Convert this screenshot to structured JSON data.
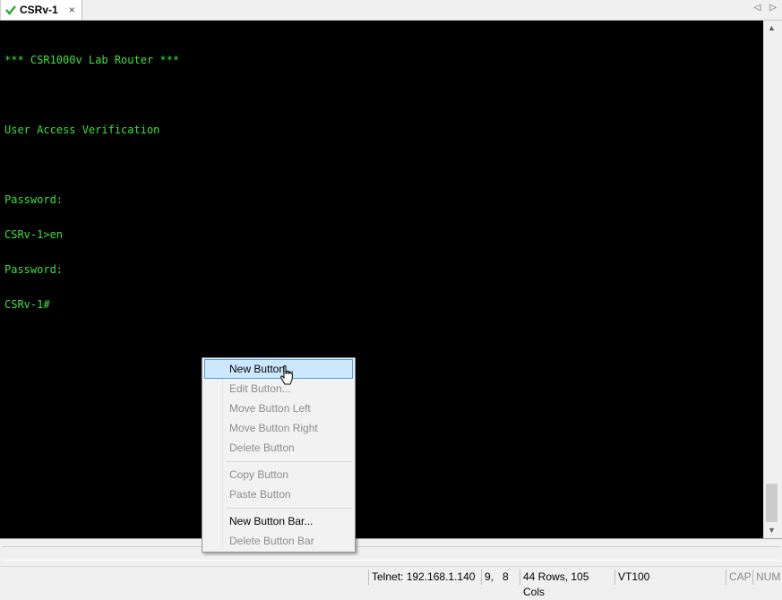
{
  "tab": {
    "label": "CSRv-1",
    "close": "×",
    "prev": "◁",
    "next": "▷"
  },
  "terminal": {
    "lines": [
      "*** CSR1000v Lab Router ***",
      "",
      "User Access Verification",
      "",
      "Password:",
      "CSRv-1>en",
      "Password:",
      "CSRv-1#"
    ]
  },
  "scrollbar": {
    "up": "▲",
    "down": "▼"
  },
  "context_menu": {
    "items": [
      {
        "label": "New Button...",
        "enabled": true,
        "highlighted": true
      },
      {
        "label": "Edit Button...",
        "enabled": false
      },
      {
        "label": "Move Button Left",
        "enabled": false
      },
      {
        "label": "Move Button Right",
        "enabled": false
      },
      {
        "label": "Delete Button",
        "enabled": false
      },
      {
        "label": "Copy Button",
        "enabled": false
      },
      {
        "label": "Paste Button",
        "enabled": false
      },
      {
        "label": "New Button Bar...",
        "enabled": true
      },
      {
        "label": "Delete Button Bar",
        "enabled": false
      }
    ]
  },
  "status": {
    "connection": "Telnet: 192.168.1.140",
    "cursor_pos": "9,   8",
    "size": "44 Rows, 105 Cols",
    "emulation": "VT100",
    "caps": "CAP",
    "num": "NUM"
  },
  "colors": {
    "terminal_text": "#3ee03e",
    "terminal_bg": "#000000",
    "menu_highlight": "#cce8ff"
  }
}
